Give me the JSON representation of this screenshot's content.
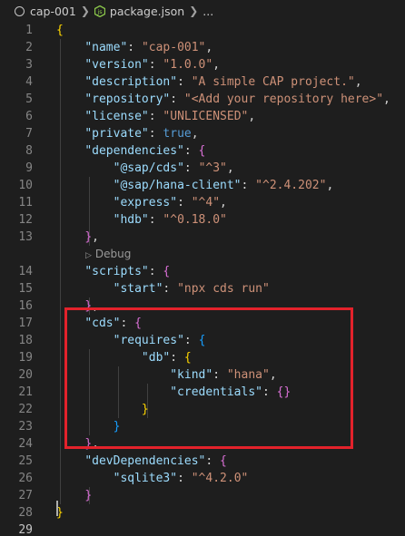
{
  "breadcrumb": {
    "folder": "cap-001",
    "file": "package.json",
    "tail": "..."
  },
  "codelens": "Debug",
  "lines": [
    {
      "n": "1",
      "t": [
        [
          "{",
          "b1"
        ]
      ]
    },
    {
      "n": "2",
      "t": [
        [
          "    ",
          "p"
        ],
        [
          "\"name\"",
          "k"
        ],
        [
          ": ",
          "p"
        ],
        [
          "\"cap-001\"",
          "s"
        ],
        [
          ",",
          "p"
        ]
      ]
    },
    {
      "n": "3",
      "t": [
        [
          "    ",
          "p"
        ],
        [
          "\"version\"",
          "k"
        ],
        [
          ": ",
          "p"
        ],
        [
          "\"1.0.0\"",
          "s"
        ],
        [
          ",",
          "p"
        ]
      ]
    },
    {
      "n": "4",
      "t": [
        [
          "    ",
          "p"
        ],
        [
          "\"description\"",
          "k"
        ],
        [
          ": ",
          "p"
        ],
        [
          "\"A simple CAP project.\"",
          "s"
        ],
        [
          ",",
          "p"
        ]
      ]
    },
    {
      "n": "5",
      "t": [
        [
          "    ",
          "p"
        ],
        [
          "\"repository\"",
          "k"
        ],
        [
          ": ",
          "p"
        ],
        [
          "\"<Add your repository here>\"",
          "s"
        ],
        [
          ",",
          "p"
        ]
      ]
    },
    {
      "n": "6",
      "t": [
        [
          "    ",
          "p"
        ],
        [
          "\"license\"",
          "k"
        ],
        [
          ": ",
          "p"
        ],
        [
          "\"UNLICENSED\"",
          "s"
        ],
        [
          ",",
          "p"
        ]
      ]
    },
    {
      "n": "7",
      "t": [
        [
          "    ",
          "p"
        ],
        [
          "\"private\"",
          "k"
        ],
        [
          ": ",
          "p"
        ],
        [
          "true",
          "kw"
        ],
        [
          ",",
          "p"
        ]
      ]
    },
    {
      "n": "8",
      "t": [
        [
          "    ",
          "p"
        ],
        [
          "\"dependencies\"",
          "k"
        ],
        [
          ": ",
          "p"
        ],
        [
          "{",
          "b2"
        ]
      ]
    },
    {
      "n": "9",
      "t": [
        [
          "        ",
          "p"
        ],
        [
          "\"@sap/cds\"",
          "k"
        ],
        [
          ": ",
          "p"
        ],
        [
          "\"^3\"",
          "s"
        ],
        [
          ",",
          "p"
        ]
      ]
    },
    {
      "n": "10",
      "t": [
        [
          "        ",
          "p"
        ],
        [
          "\"@sap/hana-client\"",
          "k"
        ],
        [
          ": ",
          "p"
        ],
        [
          "\"^2.4.202\"",
          "s"
        ],
        [
          ",",
          "p"
        ]
      ]
    },
    {
      "n": "11",
      "t": [
        [
          "        ",
          "p"
        ],
        [
          "\"express\"",
          "k"
        ],
        [
          ": ",
          "p"
        ],
        [
          "\"^4\"",
          "s"
        ],
        [
          ",",
          "p"
        ]
      ]
    },
    {
      "n": "12",
      "t": [
        [
          "        ",
          "p"
        ],
        [
          "\"hdb\"",
          "k"
        ],
        [
          ": ",
          "p"
        ],
        [
          "\"^0.18.0\"",
          "s"
        ]
      ]
    },
    {
      "n": "13",
      "t": [
        [
          "    ",
          "p"
        ],
        [
          "}",
          "b2"
        ],
        [
          ",",
          "p"
        ]
      ]
    },
    {
      "n": "14",
      "t": [
        [
          "    ",
          "p"
        ],
        [
          "\"scripts\"",
          "k"
        ],
        [
          ": ",
          "p"
        ],
        [
          "{",
          "b2"
        ]
      ]
    },
    {
      "n": "15",
      "t": [
        [
          "        ",
          "p"
        ],
        [
          "\"start\"",
          "k"
        ],
        [
          ": ",
          "p"
        ],
        [
          "\"npx cds run\"",
          "s"
        ]
      ]
    },
    {
      "n": "16",
      "t": [
        [
          "    ",
          "p"
        ],
        [
          "}",
          "b2"
        ],
        [
          ",",
          "p"
        ]
      ]
    },
    {
      "n": "17",
      "t": [
        [
          "    ",
          "p"
        ],
        [
          "\"cds\"",
          "k"
        ],
        [
          ": ",
          "p"
        ],
        [
          "{",
          "b2"
        ]
      ]
    },
    {
      "n": "18",
      "t": [
        [
          "        ",
          "p"
        ],
        [
          "\"requires\"",
          "k"
        ],
        [
          ": ",
          "p"
        ],
        [
          "{",
          "b3"
        ]
      ]
    },
    {
      "n": "19",
      "t": [
        [
          "            ",
          "p"
        ],
        [
          "\"db\"",
          "k"
        ],
        [
          ": ",
          "p"
        ],
        [
          "{",
          "b1"
        ]
      ]
    },
    {
      "n": "20",
      "t": [
        [
          "                ",
          "p"
        ],
        [
          "\"kind\"",
          "k"
        ],
        [
          ": ",
          "p"
        ],
        [
          "\"hana\"",
          "s"
        ],
        [
          ",",
          "p"
        ]
      ]
    },
    {
      "n": "21",
      "t": [
        [
          "                ",
          "p"
        ],
        [
          "\"credentials\"",
          "k"
        ],
        [
          ": ",
          "p"
        ],
        [
          "{}",
          "b2"
        ]
      ]
    },
    {
      "n": "22",
      "t": [
        [
          "            ",
          "p"
        ],
        [
          "}",
          "b1"
        ]
      ]
    },
    {
      "n": "23",
      "t": [
        [
          "        ",
          "p"
        ],
        [
          "}",
          "b3"
        ]
      ]
    },
    {
      "n": "24",
      "t": [
        [
          "    ",
          "p"
        ],
        [
          "}",
          "b2"
        ],
        [
          ",",
          "p"
        ]
      ]
    },
    {
      "n": "25",
      "t": [
        [
          "    ",
          "p"
        ],
        [
          "\"devDependencies\"",
          "k"
        ],
        [
          ": ",
          "p"
        ],
        [
          "{",
          "b2"
        ]
      ]
    },
    {
      "n": "26",
      "t": [
        [
          "        ",
          "p"
        ],
        [
          "\"sqlite3\"",
          "k"
        ],
        [
          ": ",
          "p"
        ],
        [
          "\"^4.2.0\"",
          "s"
        ]
      ]
    },
    {
      "n": "27",
      "t": [
        [
          "    ",
          "p"
        ],
        [
          "}",
          "b2"
        ]
      ]
    },
    {
      "n": "28",
      "t": [
        [
          "}",
          "b1"
        ]
      ]
    },
    {
      "n": "29",
      "t": []
    }
  ]
}
